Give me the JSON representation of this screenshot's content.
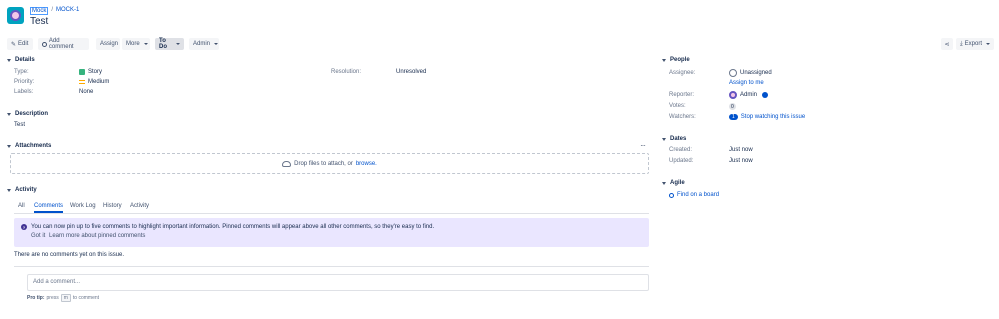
{
  "header": {
    "project_link": "Mock",
    "separator": "/",
    "issue_key": "MOCK-1",
    "issue_title": "Test",
    "avatar_icon": "project-avatar-icon"
  },
  "toolbar": {
    "edit": "Edit",
    "add_comment": "Add comment",
    "assign": "Assign",
    "more": "More",
    "status": "To Do",
    "admin": "Admin",
    "export": "Export"
  },
  "details": {
    "title": "Details",
    "type_label": "Type:",
    "type_value": "Story",
    "priority_label": "Priority:",
    "priority_value": "Medium",
    "labels_label": "Labels:",
    "labels_value": "None",
    "resolution_label": "Resolution:",
    "resolution_value": "Unresolved"
  },
  "description": {
    "title": "Description",
    "text": "Test"
  },
  "attachments": {
    "title": "Attachments",
    "drop_text": "Drop files to attach, or",
    "browse": "browse.",
    "more_icon": "ellipsis-icon"
  },
  "activity": {
    "title": "Activity",
    "tabs": [
      "All",
      "Comments",
      "Work Log",
      "History",
      "Activity"
    ],
    "active_tab": "Comments",
    "notice": "You can now pin up to five comments to highlight important information. Pinned comments will appear above all other comments, so they're easy to find.",
    "notice_got_it": "Got it",
    "notice_learn": "Learn more about pinned comments",
    "empty": "There are no comments yet on this issue.",
    "comment_placeholder": "Add a comment...",
    "pro_tip_label": "Pro tip:",
    "pro_tip_press": "press",
    "pro_tip_key": "m",
    "pro_tip_suffix": "to comment"
  },
  "people": {
    "title": "People",
    "assignee_label": "Assignee:",
    "assignee_value": "Unassigned",
    "assign_to_me": "Assign to me",
    "reporter_label": "Reporter:",
    "reporter_value": "Admin",
    "votes_label": "Votes:",
    "votes_value": "0",
    "watchers_label": "Watchers:",
    "watchers_count": "1",
    "watchers_link": "Stop watching this issue"
  },
  "dates": {
    "title": "Dates",
    "created_label": "Created:",
    "created_value": "Just now",
    "updated_label": "Updated:",
    "updated_value": "Just now"
  },
  "agile": {
    "title": "Agile",
    "find_board": "Find on a board"
  },
  "colors": {
    "link": "#0052cc",
    "notice_bg": "#eae6ff",
    "story_green": "#36b37e",
    "priority_orange": "#ffab00"
  }
}
